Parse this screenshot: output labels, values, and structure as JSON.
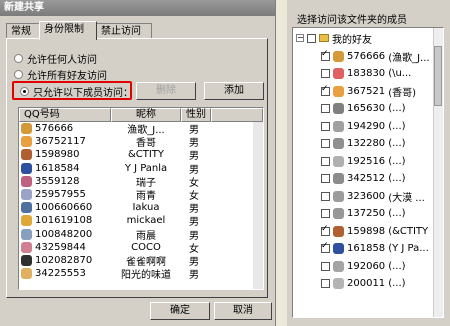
{
  "title": "新建共享",
  "tabs": [
    "常规",
    "身份限制",
    "禁止访问"
  ],
  "radios": [
    {
      "label": "允许任何人访问",
      "checked": false
    },
    {
      "label": "允许所有好友访问",
      "checked": false
    },
    {
      "label": "只允许以下成员访问：",
      "checked": true
    }
  ],
  "buttons": {
    "delete": "删除",
    "add": "添加",
    "ok": "确定",
    "cancel": "取消"
  },
  "columns": [
    "QQ号码",
    "昵称",
    "性别"
  ],
  "members": [
    {
      "qq": "576666",
      "nick": "渔歌_J...",
      "sex": "男",
      "color": "#d49a3a"
    },
    {
      "qq": "36752117",
      "nick": "香哥",
      "sex": "男",
      "color": "#e8a040"
    },
    {
      "qq": "1598980",
      "nick": "&CTITY",
      "sex": "男",
      "color": "#b06030"
    },
    {
      "qq": "1618584",
      "nick": "Y J Panla",
      "sex": "男",
      "color": "#2f4f9f"
    },
    {
      "qq": "3559128",
      "nick": "瑞子",
      "sex": "女",
      "color": "#c06080"
    },
    {
      "qq": "25957955",
      "nick": "雨青",
      "sex": "女",
      "color": "#9aa4c8"
    },
    {
      "qq": "100660660",
      "nick": "Iakua",
      "sex": "男",
      "color": "#5070a0"
    },
    {
      "qq": "101619108",
      "nick": "mickael",
      "sex": "男",
      "color": "#e0a838"
    },
    {
      "qq": "100848200",
      "nick": "雨晨",
      "sex": "男",
      "color": "#88a0c0"
    },
    {
      "qq": "43259844",
      "nick": "COCO",
      "sex": "女",
      "color": "#d08090"
    },
    {
      "qq": "102082870",
      "nick": "雀雀啊啊",
      "sex": "男",
      "color": "#303030"
    },
    {
      "qq": "34225553",
      "nick": "阳光的味道",
      "sex": "男",
      "color": "#e0b060"
    }
  ],
  "right_panel": {
    "caption": "选择访问该文件夹的成员",
    "group": "我的好友",
    "friends": [
      {
        "qq": "576666",
        "nick": "(渔歌_J...",
        "checked": true,
        "color": "#d49a3a"
      },
      {
        "qq": "183830",
        "nick": "(\\u...",
        "checked": false,
        "color": "#e06060"
      },
      {
        "qq": "367521",
        "nick": "(香哥)",
        "checked": true,
        "color": "#e8a040"
      },
      {
        "qq": "165630",
        "nick": "(...)",
        "checked": false,
        "color": "#808080"
      },
      {
        "qq": "194290",
        "nick": "(...)",
        "checked": false,
        "color": "#a0a0a0"
      },
      {
        "qq": "132280",
        "nick": "(...)",
        "checked": false,
        "color": "#909090"
      },
      {
        "qq": "192516",
        "nick": "(...)",
        "checked": false,
        "color": "#b0b0b0"
      },
      {
        "qq": "342512",
        "nick": "(...)",
        "checked": false,
        "color": "#8c8c8c"
      },
      {
        "qq": "323600",
        "nick": "(大漠 ...",
        "checked": false,
        "color": "#9c9c9c"
      },
      {
        "qq": "137250",
        "nick": "(...)",
        "checked": false,
        "color": "#989898"
      },
      {
        "qq": "159898",
        "nick": "(&CTITY",
        "checked": true,
        "color": "#b06030"
      },
      {
        "qq": "161858",
        "nick": "(Y J Pa...",
        "checked": true,
        "color": "#2f4f9f"
      },
      {
        "qq": "192060",
        "nick": "(...)",
        "checked": false,
        "color": "#a4a4a4"
      },
      {
        "qq": "200011",
        "nick": "(...)",
        "checked": false,
        "color": "#b4b4b4"
      }
    ]
  }
}
